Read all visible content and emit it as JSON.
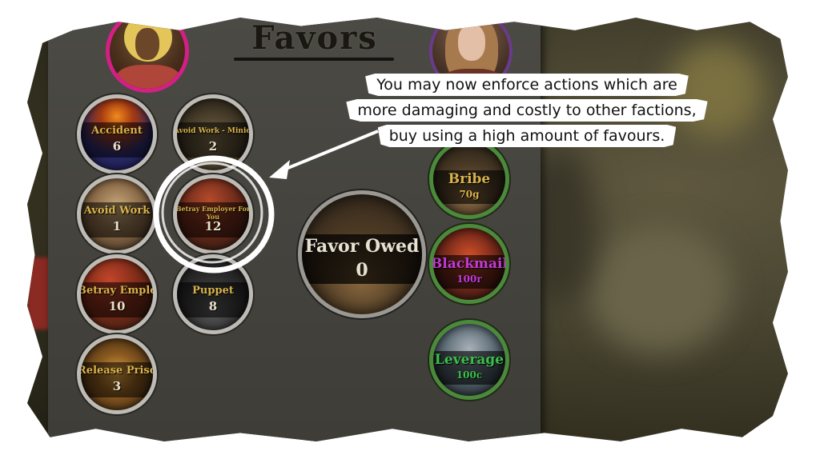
{
  "panel": {
    "title": "Favors"
  },
  "favors": [
    {
      "id": "accident",
      "name": "Accident",
      "count": "6"
    },
    {
      "id": "avoid-work-minions",
      "name": "Avoid Work - Minions",
      "count": "2"
    },
    {
      "id": "avoid-work",
      "name": "Avoid Work",
      "count": "1"
    },
    {
      "id": "betray-employer-for-you",
      "name": "Betray Employer For You",
      "count": "12"
    },
    {
      "id": "betray-employer",
      "name": "Betray Employer",
      "count": "10"
    },
    {
      "id": "puppet",
      "name": "Puppet",
      "count": "8"
    },
    {
      "id": "release-prisoner",
      "name": "Release Prisoner",
      "count": "3"
    }
  ],
  "favor_owed": {
    "label": "Favor Owed",
    "value": "0"
  },
  "actions": [
    {
      "id": "bribe",
      "name": "Bribe",
      "cost": "70g",
      "color": "#d8b24a"
    },
    {
      "id": "blackmail",
      "name": "Blackmail",
      "cost": "100r",
      "color": "#c23bd6"
    },
    {
      "id": "leverage",
      "name": "Leverage",
      "cost": "100c",
      "color": "#3bbf4a"
    }
  ],
  "callout": {
    "lines": [
      "You may now enforce actions which are",
      "more damaging and costly to other factions,",
      "buy using a high amount of favours."
    ]
  },
  "colors": {
    "favor_text": "#d8b24a",
    "portrait_left_ring": "#d31f86",
    "portrait_right_ring": "#6a3b8a",
    "action_ring": "#4b8a3a"
  }
}
